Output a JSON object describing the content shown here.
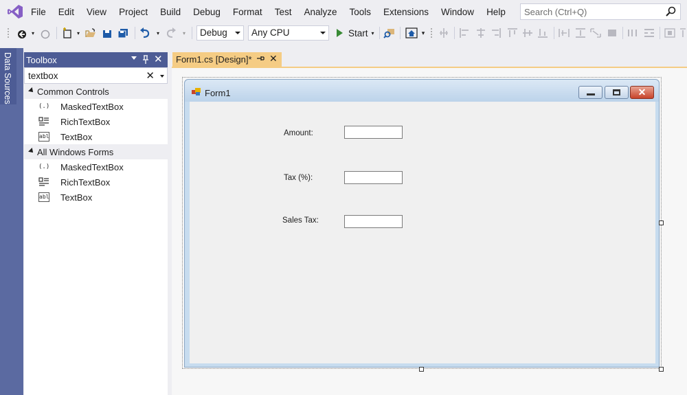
{
  "menu": {
    "items": [
      "File",
      "Edit",
      "View",
      "Project",
      "Build",
      "Debug",
      "Format",
      "Test",
      "Analyze",
      "Tools",
      "Extensions",
      "Window",
      "Help"
    ],
    "search_placeholder": "Search (Ctrl+Q)"
  },
  "toolbar": {
    "config": "Debug",
    "platform": "Any CPU",
    "start_label": "Start"
  },
  "side_strip": {
    "data_sources_label": "Data Sources"
  },
  "toolbox": {
    "title": "Toolbox",
    "search_value": "textbox",
    "groups": [
      {
        "label": "Common Controls",
        "items": [
          {
            "icon": "(.)",
            "label": "MaskedTextBox"
          },
          {
            "icon": "rtb",
            "label": "RichTextBox"
          },
          {
            "icon": "abl",
            "label": "TextBox"
          }
        ]
      },
      {
        "label": "All Windows Forms",
        "items": [
          {
            "icon": "(.)",
            "label": "MaskedTextBox"
          },
          {
            "icon": "rtb",
            "label": "RichTextBox"
          },
          {
            "icon": "abl",
            "label": "TextBox"
          }
        ]
      }
    ]
  },
  "document": {
    "tab_label": "Form1.cs [Design]*"
  },
  "form": {
    "title": "Form1",
    "labels": {
      "amount": "Amount:",
      "tax": "Tax (%):",
      "sales_tax": "Sales Tax:"
    }
  },
  "colors": {
    "accent": "#5b6aa1",
    "active_tab": "#f5cc84",
    "vs_purple": "#68217a"
  }
}
